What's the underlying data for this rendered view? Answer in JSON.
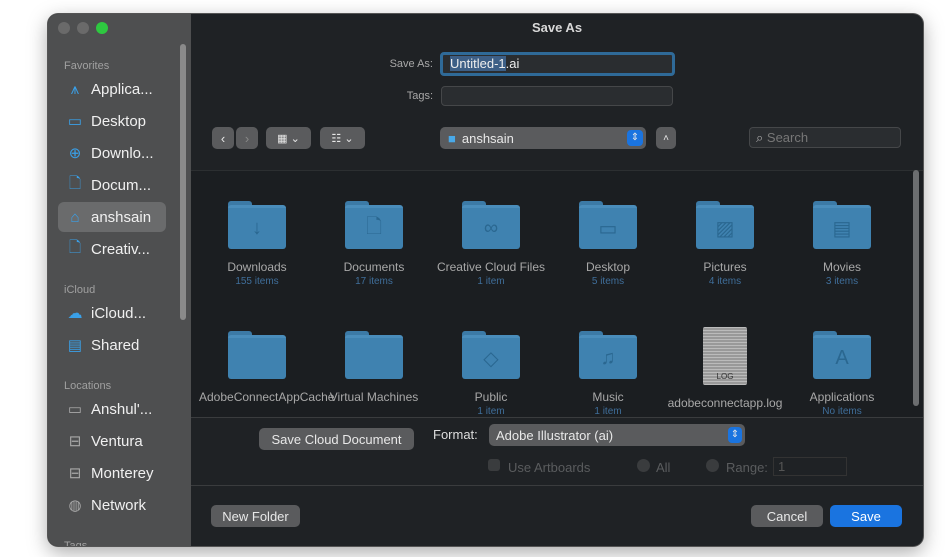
{
  "window": {
    "title": "Save As"
  },
  "sidebar": {
    "sections": [
      {
        "heading": "Favorites",
        "items": [
          {
            "label": "Applica...",
            "icon": "applications-icon"
          },
          {
            "label": "Desktop",
            "icon": "desktop-icon"
          },
          {
            "label": "Downlo...",
            "icon": "downloads-icon"
          },
          {
            "label": "Docum...",
            "icon": "document-icon"
          },
          {
            "label": "anshsain",
            "icon": "home-icon",
            "selected": true
          },
          {
            "label": "Creativ...",
            "icon": "document-icon"
          }
        ]
      },
      {
        "heading": "iCloud",
        "items": [
          {
            "label": "iCloud...",
            "icon": "cloud-icon"
          },
          {
            "label": "Shared",
            "icon": "shared-folder-icon"
          }
        ]
      },
      {
        "heading": "Locations",
        "items": [
          {
            "label": "Anshul'...",
            "icon": "laptop-icon"
          },
          {
            "label": "Ventura",
            "icon": "disk-icon"
          },
          {
            "label": "Monterey",
            "icon": "disk-icon"
          },
          {
            "label": "Network",
            "icon": "globe-icon"
          }
        ]
      },
      {
        "heading": "Tags",
        "items": []
      }
    ]
  },
  "form": {
    "save_as_label": "Save As:",
    "filename_selected": "Untitled-1",
    "filename_ext": ".ai",
    "tags_label": "Tags:",
    "tags_value": ""
  },
  "toolbar": {
    "location": "anshsain",
    "search_placeholder": "Search"
  },
  "files": [
    {
      "name": "Downloads",
      "count": "155 items",
      "glyph": "↓"
    },
    {
      "name": "Documents",
      "count": "17 items",
      "glyph": "🗋"
    },
    {
      "name": "Creative Cloud Files",
      "count": "1 item",
      "glyph": "∞"
    },
    {
      "name": "Desktop",
      "count": "5 items",
      "glyph": "▭"
    },
    {
      "name": "Pictures",
      "count": "4 items",
      "glyph": "▨"
    },
    {
      "name": "Movies",
      "count": "3 items",
      "glyph": "▤"
    },
    {
      "name": "AdobeConnectAppCache",
      "count": "",
      "glyph": ""
    },
    {
      "name": "Virtual Machines",
      "count": "",
      "glyph": ""
    },
    {
      "name": "Public",
      "count": "1 item",
      "glyph": "◇"
    },
    {
      "name": "Music",
      "count": "1 item",
      "glyph": "♫"
    },
    {
      "name": "adobeconnectapp.log",
      "count": "",
      "glyph": "",
      "doc": "LOG"
    },
    {
      "name": "Applications",
      "count": "No items",
      "glyph": "A"
    }
  ],
  "options": {
    "save_cloud": "Save Cloud Document",
    "format_label": "Format:",
    "format_value": "Adobe Illustrator (ai)",
    "use_artboards": "Use Artboards",
    "all": "All",
    "range": "Range:",
    "range_value": "1"
  },
  "footer": {
    "new_folder": "New Folder",
    "cancel": "Cancel",
    "save": "Save"
  },
  "colors": {
    "accent": "#1a74e0",
    "folder": "#3f82b0"
  }
}
